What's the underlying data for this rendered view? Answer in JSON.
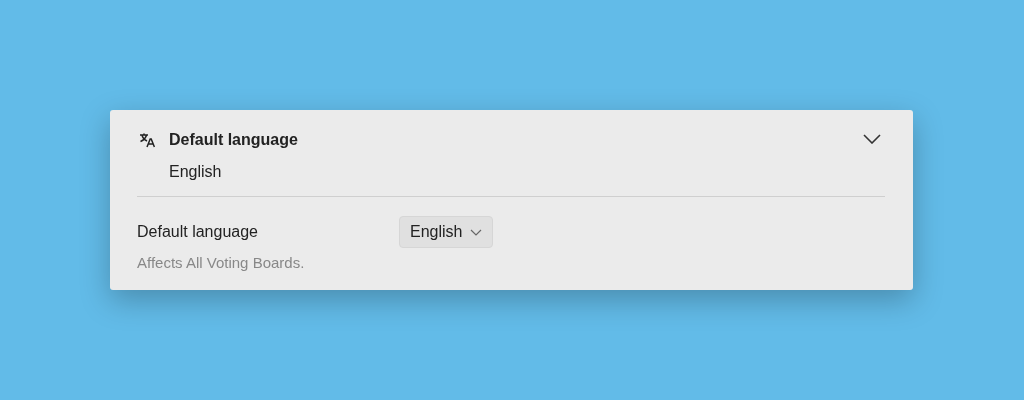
{
  "panel": {
    "title": "Default language",
    "summary": "English",
    "expanded": true
  },
  "setting": {
    "label": "Default language",
    "value": "English",
    "help": "Affects All Voting Boards."
  }
}
